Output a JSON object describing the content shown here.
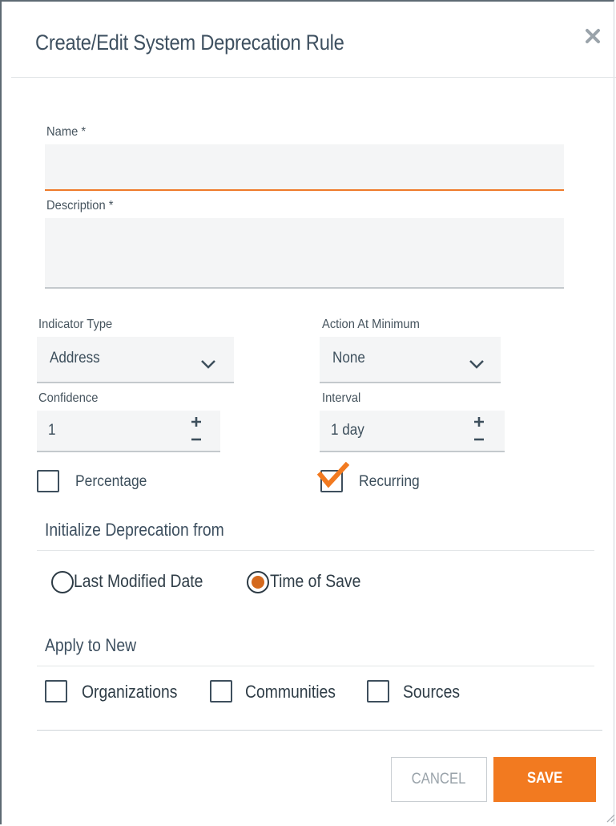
{
  "dialog": {
    "title": "Create/Edit System Deprecation Rule",
    "close_icon": "close-icon"
  },
  "fields": {
    "name_label": "Name *",
    "name_value": "",
    "description_label": "Description *",
    "description_value": "",
    "indicator_type_label": "Indicator Type",
    "indicator_type_value": "Address",
    "action_at_minimum_label": "Action At Minimum",
    "action_at_minimum_value": "None",
    "confidence_label": "Confidence",
    "confidence_value": "1",
    "interval_label": "Interval",
    "interval_value": "1 day"
  },
  "checkboxes": {
    "percentage_label": "Percentage",
    "percentage_checked": false,
    "recurring_label": "Recurring",
    "recurring_checked": true
  },
  "initialize": {
    "heading": "Initialize Deprecation from",
    "options": [
      {
        "label": "Last Modified Date",
        "selected": false
      },
      {
        "label": "Time of Save",
        "selected": true
      }
    ]
  },
  "apply_to_new": {
    "heading": "Apply to New",
    "options": [
      {
        "label": "Organizations",
        "checked": false
      },
      {
        "label": "Communities",
        "checked": false
      },
      {
        "label": "Sources",
        "checked": false
      }
    ]
  },
  "buttons": {
    "cancel_label": "CANCEL",
    "save_label": "SAVE"
  },
  "colors": {
    "accent": "#f27a20",
    "text": "#3d4f5c",
    "field_bg": "#f4f5f6"
  }
}
